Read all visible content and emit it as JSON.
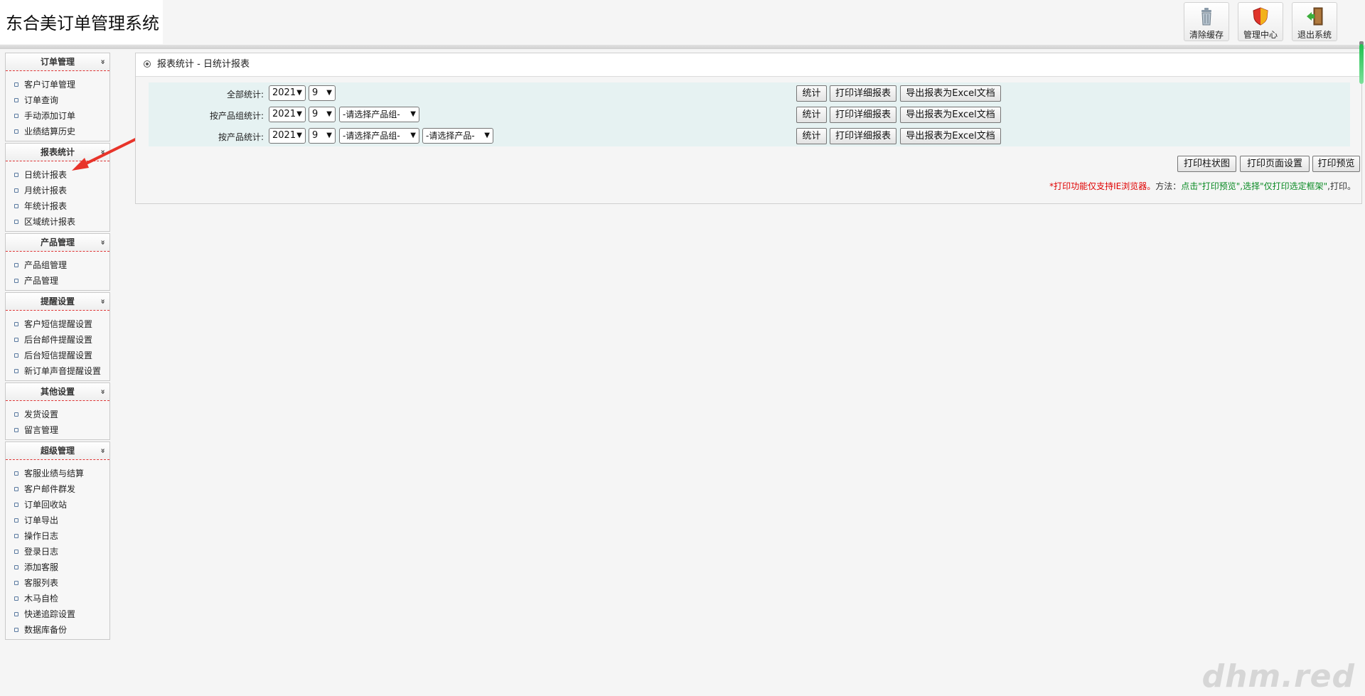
{
  "header": {
    "title": "东合美订单管理系统",
    "buttons": [
      {
        "label": "清除缓存",
        "icon": "trash-can-icon"
      },
      {
        "label": "管理中心",
        "icon": "shield-icon"
      },
      {
        "label": "退出系统",
        "icon": "exit-door-icon"
      }
    ]
  },
  "sidebar": {
    "groups": [
      {
        "title": "订单管理",
        "items": [
          "客户订单管理",
          "订单查询",
          "手动添加订单",
          "业绩结算历史"
        ]
      },
      {
        "title": "报表统计",
        "items": [
          "日统计报表",
          "月统计报表",
          "年统计报表",
          "区域统计报表"
        ]
      },
      {
        "title": "产品管理",
        "items": [
          "产品组管理",
          "产品管理"
        ]
      },
      {
        "title": "提醒设置",
        "items": [
          "客户短信提醒设置",
          "后台邮件提醒设置",
          "后台短信提醒设置",
          "新订单声音提醒设置"
        ]
      },
      {
        "title": "其他设置",
        "items": [
          "发货设置",
          "留言管理"
        ]
      },
      {
        "title": "超级管理",
        "items": [
          "客服业绩与结算",
          "客户邮件群发",
          "订单回收站",
          "订单导出",
          "操作日志",
          "登录日志",
          "添加客服",
          "客服列表",
          "木马自检",
          "快递追踪设置",
          "数据库备份"
        ]
      }
    ],
    "chevron": "»"
  },
  "main": {
    "title": "报表统计 - 日统计报表",
    "rows": [
      {
        "label": "全部统计:",
        "year": "2021",
        "month": "9",
        "group": "",
        "product": ""
      },
      {
        "label": "按产品组统计:",
        "year": "2021",
        "month": "9",
        "group": "-请选择产品组-",
        "product": ""
      },
      {
        "label": "按产品统计:",
        "year": "2021",
        "month": "9",
        "group": "-请选择产品组-",
        "product": "-请选择产品-"
      }
    ],
    "row_buttons": {
      "stat": "统计",
      "print_detail": "打印详细报表",
      "export_excel": "导出报表为Excel文档"
    },
    "print_buttons": {
      "bar_chart": "打印柱状图",
      "page_setup": "打印页面设置",
      "preview": "打印预览"
    },
    "note": {
      "red": "*打印功能仅支持IE浏览器。",
      "black1": "方法：",
      "green": "点击\"打印预览\",选择\"仅打印选定框架\"",
      "black2": ",打印。"
    }
  },
  "watermark": "dhm.red",
  "colors": {
    "accent_red": "#e00000",
    "note_green": "#0a8a24",
    "row_bg": "#e6f2f2",
    "arrow": "#e8342a"
  }
}
